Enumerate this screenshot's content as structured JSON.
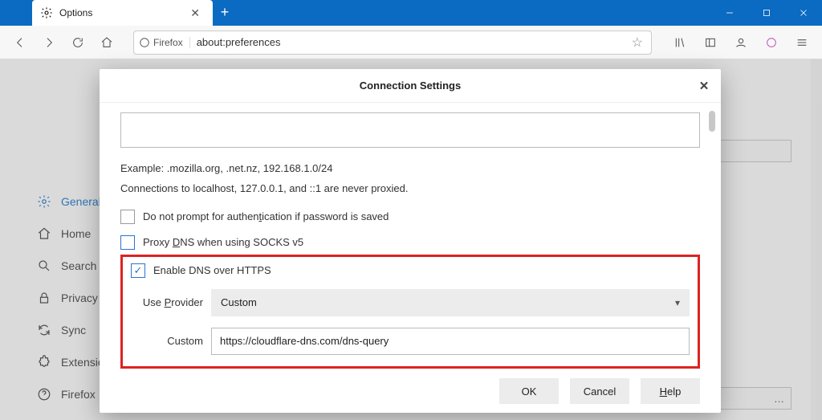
{
  "tab": {
    "title": "Options"
  },
  "urlbar": {
    "badge": "Firefox",
    "url": "about:preferences"
  },
  "sidebar": {
    "items": [
      {
        "label": "General"
      },
      {
        "label": "Home"
      },
      {
        "label": "Search"
      },
      {
        "label": "Privacy"
      },
      {
        "label": "Sync"
      },
      {
        "label": "Extensions"
      },
      {
        "label": "Firefox"
      }
    ]
  },
  "corner": {
    "dots": "…"
  },
  "dialog": {
    "title": "Connection Settings",
    "example": "Example: .mozilla.org, .net.nz, 192.168.1.0/24",
    "localhost": "Connections to localhost, 127.0.0.1, and ::1 are never proxied.",
    "chk_noprompt_pre": "Do not prompt for authen",
    "chk_noprompt_u": "t",
    "chk_noprompt_post": "ication if password is saved",
    "chk_proxydns_pre": "Proxy ",
    "chk_proxydns_u": "D",
    "chk_proxydns_post": "NS when using SOCKS v5",
    "chk_doh": "Enable DNS over HTTPS",
    "provider_lbl_pre": "Use ",
    "provider_lbl_u": "P",
    "provider_lbl_post": "rovider",
    "provider_value": "Custom",
    "custom_lbl": "Custom",
    "custom_value": "https://cloudflare-dns.com/dns-query",
    "ok": "OK",
    "cancel": "Cancel",
    "help_u": "H",
    "help_post": "elp"
  }
}
